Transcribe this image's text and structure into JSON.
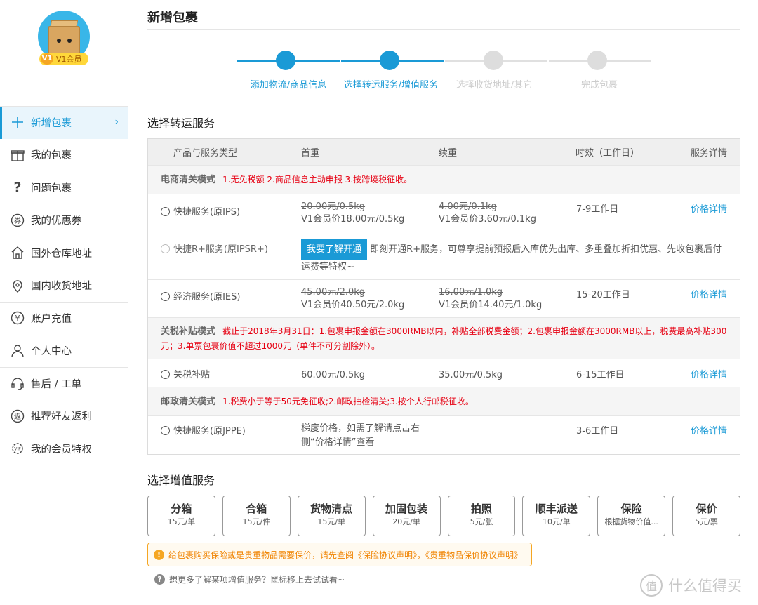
{
  "sidebar": {
    "vip_level": "V1",
    "vip_label": "V1会员",
    "items": [
      {
        "label": "新增包裹",
        "icon": "plus-icon",
        "active": true
      },
      {
        "label": "我的包裹",
        "icon": "gift-icon"
      },
      {
        "label": "问题包裹",
        "icon": "question-icon"
      },
      {
        "label": "我的优惠券",
        "icon": "coupon-icon"
      },
      {
        "label": "国外仓库地址",
        "icon": "house-icon"
      },
      {
        "label": "国内收货地址",
        "icon": "location-pin-icon"
      },
      {
        "label": "账户充值",
        "icon": "yen-icon"
      },
      {
        "label": "个人中心",
        "icon": "user-icon"
      },
      {
        "label": "售后 / 工单",
        "icon": "headset-icon"
      },
      {
        "label": "推荐好友返利",
        "icon": "rebate-icon"
      },
      {
        "label": "我的会员特权",
        "icon": "vip-gear-icon"
      }
    ]
  },
  "page_title": "新增包裹",
  "steps": [
    {
      "label": "添加物流/商品信息",
      "state": "done"
    },
    {
      "label": "选择转运服务/增值服务",
      "state": "current"
    },
    {
      "label": "选择收货地址/其它",
      "state": "pending"
    },
    {
      "label": "完成包裹",
      "state": "pending"
    }
  ],
  "transfer_section_title": "选择转运服务",
  "table": {
    "headers": [
      "产品与服务类型",
      "首重",
      "续重",
      "时效（工作日）",
      "服务详情"
    ],
    "groups": [
      {
        "mode": "电商清关模式",
        "desc": "1.无免税额 2.商品信息主动申报 3.按跨境税征收。",
        "rows": [
          {
            "name": "快捷服务(原IPS)",
            "first_orig": "20.00元/0.5kg",
            "first_vip": "V1会员价18.00元/0.5kg",
            "next_orig": "4.00元/0.1kg",
            "next_vip": "V1会员价3.60元/0.1kg",
            "time": "7-9工作日",
            "detail": "价格详情"
          }
        ],
        "rplus": {
          "name": "快捷R+服务(原IPSR+)",
          "button": "我要了解开通",
          "desc": "即刻开通R+服务，可尊享提前预报后入库优先出库、多重叠加折扣优惠、先收包裹后付运费等特权~"
        },
        "rows2": [
          {
            "name": "经济服务(原IES)",
            "first_orig": "45.00元/2.0kg",
            "first_vip": "V1会员价40.50元/2.0kg",
            "next_orig": "16.00元/1.0kg",
            "next_vip": "V1会员价14.40元/1.0kg",
            "time": "15-20工作日",
            "detail": "价格详情"
          }
        ]
      },
      {
        "mode": "关税补贴模式",
        "desc": "截止于2018年3月31日：1.包裹申报金额在3000RMB以内，补贴全部税费金额；2.包裹申报金额在3000RMB以上，税费最高补贴300元；3.单票包裹价值不超过1000元（单件不可分割除外）。",
        "rows": [
          {
            "name": "关税补贴",
            "first": "60.00元/0.5kg",
            "next": "35.00元/0.5kg",
            "time": "6-15工作日",
            "detail": "价格详情"
          }
        ]
      },
      {
        "mode": "邮政清关模式",
        "desc": "1.税费小于等于50元免征收;2.邮政抽检清关;3.按个人行邮税征收。",
        "rows": [
          {
            "name": "快捷服务(原JPPE)",
            "first": "梯度价格，如需了解请点击右侧“价格详情”查看",
            "time": "3-6工作日",
            "detail": "价格详情"
          }
        ]
      }
    ]
  },
  "value_section_title": "选择增值服务",
  "value_services": [
    {
      "name": "分箱",
      "price": "15元/单"
    },
    {
      "name": "合箱",
      "price": "15元/件"
    },
    {
      "name": "货物清点",
      "price": "15元/单"
    },
    {
      "name": "加固包装",
      "price": "20元/单"
    },
    {
      "name": "拍照",
      "price": "5元/张"
    },
    {
      "name": "顺丰派送",
      "price": "10元/单"
    },
    {
      "name": "保险",
      "price": "根据货物价值..."
    },
    {
      "name": "保价",
      "price": "5元/票"
    }
  ],
  "notice": "给包裹购买保险或是贵重物品需要保价，请先查阅《保险协议声明》，《贵重物品保价协议声明》",
  "hint": "想更多了解某项增值服务？鼠标移上去试试看~",
  "watermark": "什么值得买",
  "colors": {
    "accent": "#1a9ad6",
    "warning": "#f08300",
    "danger": "#e60012"
  }
}
